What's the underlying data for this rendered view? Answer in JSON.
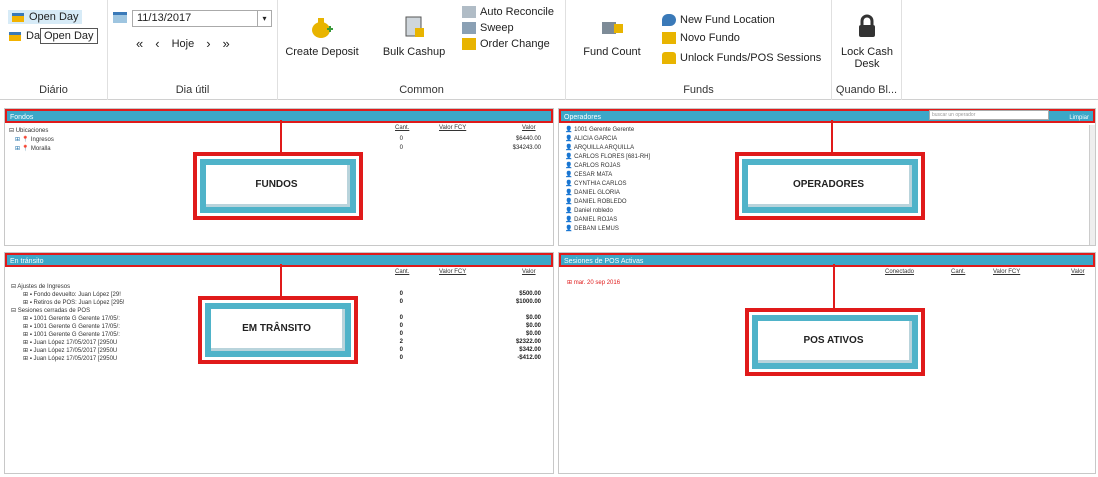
{
  "ribbon": {
    "diario": {
      "open_day_label": "Open Day",
      "da_label": "Da",
      "tooltip": "Open Day",
      "group_label": "Diário"
    },
    "dia_util": {
      "date_value": "11/13/2017",
      "hoje_label": "Hoje",
      "group_label": "Dia útil"
    },
    "common": {
      "create_deposit": "Create Deposit",
      "bulk_cashup": "Bulk Cashup",
      "auto_reconcile": "Auto Reconcile",
      "sweep": "Sweep",
      "order_change": "Order Change",
      "group_label": "Common"
    },
    "funds": {
      "fund_count": "Fund Count",
      "new_fund_location": "New Fund Location",
      "novo_fundo": "Novo Fundo",
      "unlock": "Unlock Funds/POS Sessions",
      "group_label": "Funds"
    },
    "quando": {
      "lock_cash_desk_1": "Lock Cash",
      "lock_cash_desk_2": "Desk",
      "group_label": "Quando Bl..."
    }
  },
  "fondos": {
    "title": "Fondos",
    "col_cant": "Cant.",
    "col_valor_fcy": "Valor FCY",
    "col_valor": "Valor",
    "root": "Ubicaciones",
    "rows": [
      {
        "label": "Ingresos",
        "cant": "0",
        "valor": "$6440.00"
      },
      {
        "label": "Moralla",
        "cant": "0",
        "valor": "$34243.00"
      }
    ],
    "callout": "FUNDOS"
  },
  "operadores": {
    "title": "Operadores",
    "search_placeholder": "buscar un operador",
    "limpiar": "Limpiar",
    "items": [
      "1001 Gerente Gerente",
      "ALICIA GARCIA",
      "ARQUILLA ARQUILLA",
      "CARLOS FLORES   [681-RH]",
      "CARLOS ROJAS",
      "CESAR MATA",
      "CYNTHIA CARLOS",
      "DANIEL GLORIA",
      "DANIEL ROBLEDO",
      "Daniel robledo",
      "DANIEL ROJAS",
      "DEBANI LEMUS"
    ],
    "callout": "OPERADORES"
  },
  "transito": {
    "title": "En tránsito",
    "col_cant": "Cant.",
    "col_valor_fcy": "Valor FCY",
    "col_valor": "Valor",
    "rows": [
      {
        "label": "Ajustes de Ingresos",
        "indent": 0,
        "cant": "",
        "valor": ""
      },
      {
        "label": "Fondo devuelto: Juan López [29!",
        "indent": 1,
        "cant": "0",
        "valor": "$500.00"
      },
      {
        "label": "Retiros de POS: Juan López [295!",
        "indent": 1,
        "cant": "0",
        "valor": "$1000.00"
      },
      {
        "label": "Sesiones cerradas de POS",
        "indent": 0,
        "cant": "",
        "valor": ""
      },
      {
        "label": "1001 Gerente G Gerente 17/05/:",
        "indent": 1,
        "cant": "0",
        "valor": "$0.00"
      },
      {
        "label": "1001 Gerente G Gerente 17/05/:",
        "indent": 1,
        "cant": "0",
        "valor": "$0.00"
      },
      {
        "label": "1001 Gerente G Gerente 17/05/:",
        "indent": 1,
        "cant": "0",
        "valor": "$0.00"
      },
      {
        "label": "Juan López 17/05/2017 [2950U",
        "indent": 1,
        "cant": "2",
        "valor": "$2322.00"
      },
      {
        "label": "Juan López 17/05/2017 [2950U",
        "indent": 1,
        "cant": "0",
        "valor": "$342.00"
      },
      {
        "label": "Juan López 17/05/2017 [2950U",
        "indent": 1,
        "cant": "0",
        "valor": "-$412.00"
      }
    ],
    "callout": "EM TRÂNSITO"
  },
  "pos": {
    "title": "Sesiones de POS Activas",
    "col_conectado": "Conectado",
    "col_cant": "Cant.",
    "col_valor_fcy": "Valor FCY",
    "col_valor": "Valor",
    "date_row": "mar. 20 sep 2016",
    "callout": "POS ATIVOS"
  },
  "colors": {
    "header": "#3ca7c8",
    "callout_border": "#e01a1a",
    "callout_inner": "#4fb3c9"
  }
}
